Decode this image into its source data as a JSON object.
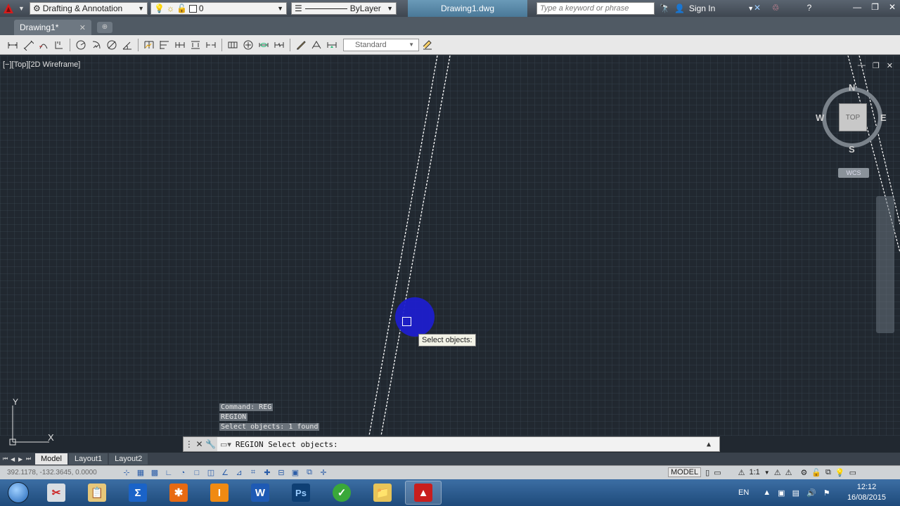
{
  "titlebar": {
    "workspace": "Drafting & Annotation",
    "layer": "0",
    "linetype": "ByLayer",
    "document_title": "Drawing1.dwg",
    "search_placeholder": "Type a keyword or phrase",
    "signin_label": "Sign In"
  },
  "tabs": {
    "active_doc": "Drawing1*"
  },
  "toolbar": {
    "dim_style": "Standard",
    "icons": [
      "linear-dim-icon",
      "aligned-dim-icon",
      "arc-length-icon",
      "ordinate-icon",
      "radius-icon",
      "jogged-icon",
      "diameter-icon",
      "angular-icon",
      "quick-dim-icon",
      "baseline-icon",
      "continue-icon",
      "space-icon",
      "break-icon",
      "tolerance-icon",
      "center-mark-icon",
      "inspect-icon",
      "jogged-linear-icon",
      "dim-edit-icon",
      "dim-text-edit-icon",
      "dim-update-icon"
    ]
  },
  "viewport": {
    "label": "[−][Top][2D Wireframe]",
    "cube_face": "TOP",
    "dir_n": "N",
    "dir_s": "S",
    "dir_e": "E",
    "dir_w": "W",
    "wcs": "WCS",
    "ucs_x": "X",
    "ucs_y": "Y",
    "tooltip": "Select objects:",
    "colors": {
      "background": "#212830",
      "line": "#ffffff",
      "halo": "#1e1ecc"
    }
  },
  "command": {
    "history": [
      "Command: REG",
      "REGION",
      "Select objects: 1 found"
    ],
    "current": "REGION Select objects:"
  },
  "layouts": {
    "tabs": [
      "Model",
      "Layout1",
      "Layout2"
    ],
    "active": "Model"
  },
  "status": {
    "coords": "392.1178, -132.3645, 0.0000",
    "model_label": "MODEL",
    "scale": "1:1"
  },
  "taskbar": {
    "apps": [
      {
        "name": "start",
        "label": ""
      },
      {
        "name": "snipping-tool",
        "label": ""
      },
      {
        "name": "clipboard",
        "label": ""
      },
      {
        "name": "sigma-app",
        "label": "Σ"
      },
      {
        "name": "xara-app",
        "label": ""
      },
      {
        "name": "illustrator-app",
        "label": "I"
      },
      {
        "name": "word-app",
        "label": "W"
      },
      {
        "name": "photoshop-app",
        "label": "Ps"
      },
      {
        "name": "corel-app",
        "label": ""
      },
      {
        "name": "explorer-app",
        "label": ""
      },
      {
        "name": "autocad-app",
        "label": ""
      }
    ],
    "language": "EN",
    "time": "12:12",
    "date": "16/08/2015"
  }
}
